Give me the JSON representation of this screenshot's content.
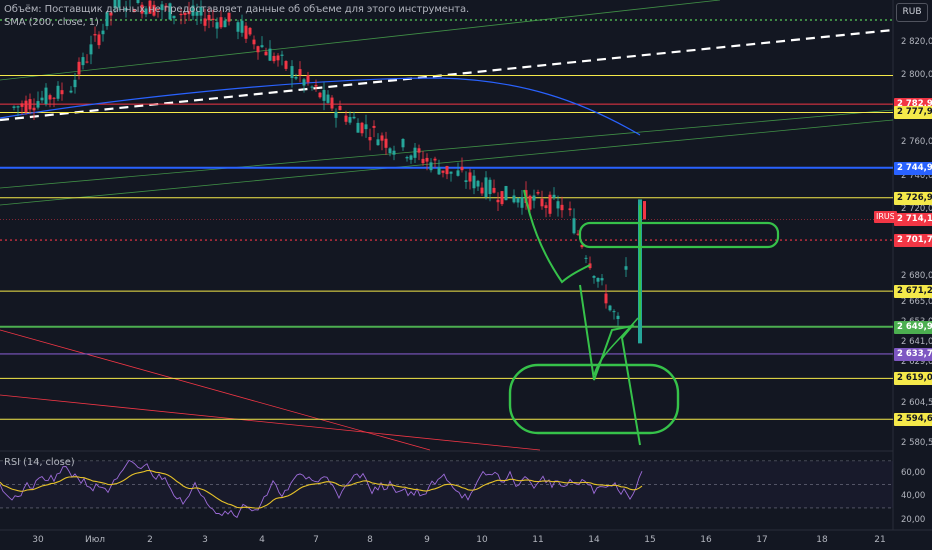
{
  "legend": {
    "volume": "Объём: Поставщик данных не предоставляет данные об объеме для этого инструмента.",
    "sma": "SMA (200, close, 1)",
    "rsi": "RSI (14, close)"
  },
  "currency": "RUB",
  "symbol": "IRUS",
  "colors": {
    "background": "#131722",
    "up": "#26a69a",
    "down": "#f23645",
    "yellow_level": "#f5e94a",
    "green_level": "#4caf50",
    "blue_level": "#2962ff",
    "purple_level": "#7e57c2",
    "rsi_line": "#9c6bd8",
    "rsi_ma": "#e6c229",
    "drawing": "#36c24a"
  },
  "price_axis": {
    "ticks": [
      "2 820,00",
      "2 800,00",
      "2 760,00",
      "2 740,00",
      "2 720,00",
      "2 680,00",
      "2 665,00",
      "2 653,00",
      "2 641,00",
      "2 629,00",
      "2 604,50",
      "2 580,50"
    ],
    "labels": [
      {
        "value": "2 782,93",
        "color": "#f23645"
      },
      {
        "value": "2 777,93",
        "color": "#f5e94a"
      },
      {
        "value": "2 744,93",
        "color": "#2962ff"
      },
      {
        "value": "2 726,97",
        "color": "#f5e94a"
      },
      {
        "value": "2 714,14",
        "color": "#f23645"
      },
      {
        "value": "2 701,70",
        "color": "#f23645"
      },
      {
        "value": "2 671,23",
        "color": "#f5e94a"
      },
      {
        "value": "2 649,96",
        "color": "#4caf50"
      },
      {
        "value": "2 633,70",
        "color": "#7e57c2"
      },
      {
        "value": "2 619,09",
        "color": "#f5e94a"
      },
      {
        "value": "2 594,65",
        "color": "#f5e94a"
      }
    ]
  },
  "rsi_axis": {
    "ticks": [
      "60,00",
      "40,00",
      "20,00"
    ]
  },
  "time_axis": {
    "ticks": [
      "30",
      "Июл",
      "2",
      "3",
      "4",
      "7",
      "8",
      "9",
      "10",
      "11",
      "14",
      "15",
      "16",
      "17",
      "18",
      "21"
    ]
  },
  "chart_data": {
    "type": "candlestick",
    "note_series": "approximate OHLC read from chart",
    "x": [
      "30",
      "Июл",
      "2",
      "3",
      "4",
      "7",
      "8",
      "9",
      "10",
      "11",
      "14",
      "15"
    ],
    "closes": [
      2790,
      2845,
      2838,
      2832,
      2805,
      2778,
      2758,
      2742,
      2728,
      2722,
      2652,
      2714.14
    ],
    "horizontal_levels": [
      2782.93,
      2777.93,
      2744.93,
      2726.97,
      2701.7,
      2671.23,
      2649.96,
      2633.7,
      2619.09,
      2594.65
    ],
    "rsi_ticks": [
      60,
      40,
      20
    ]
  }
}
